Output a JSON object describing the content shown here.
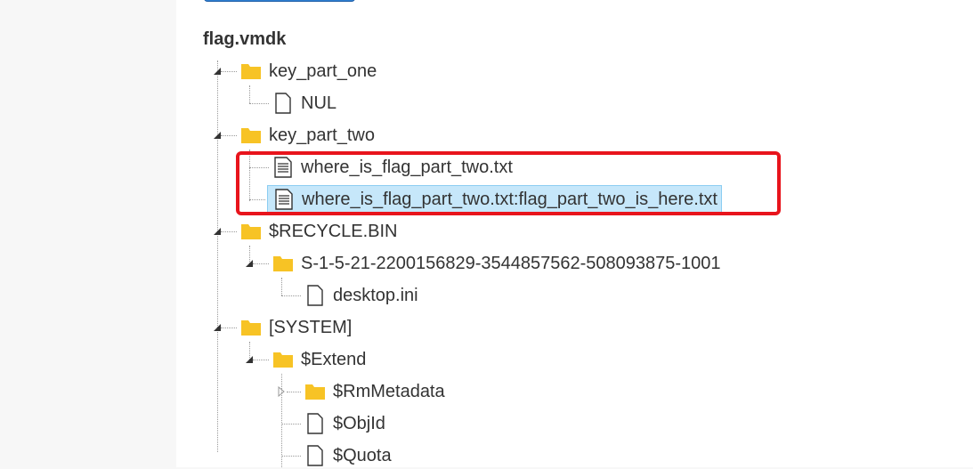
{
  "tree": {
    "root_label": "flag.vmdk",
    "nodes": [
      {
        "label": "key_part_one",
        "type": "folder",
        "state": "expanded"
      },
      {
        "label": "NUL",
        "type": "file"
      },
      {
        "label": "key_part_two",
        "type": "folder",
        "state": "expanded"
      },
      {
        "label": "where_is_flag_part_two.txt",
        "type": "text-file"
      },
      {
        "label": "where_is_flag_part_two.txt:flag_part_two_is_here.txt",
        "type": "text-file",
        "selected": true
      },
      {
        "label": "$RECYCLE.BIN",
        "type": "folder",
        "state": "expanded"
      },
      {
        "label": "S-1-5-21-2200156829-3544857562-508093875-1001",
        "type": "folder",
        "state": "expanded"
      },
      {
        "label": "desktop.ini",
        "type": "file"
      },
      {
        "label": "[SYSTEM]",
        "type": "folder",
        "state": "expanded"
      },
      {
        "label": "$Extend",
        "type": "folder",
        "state": "expanded"
      },
      {
        "label": "$RmMetadata",
        "type": "folder",
        "state": "collapsed"
      },
      {
        "label": "$ObjId",
        "type": "file"
      },
      {
        "label": "$Quota",
        "type": "file"
      }
    ]
  },
  "colors": {
    "folder": "#f7c325",
    "selection_bg": "#c6e7fa",
    "selection_border": "#8ccdf2",
    "highlight_box": "#e8141c"
  }
}
